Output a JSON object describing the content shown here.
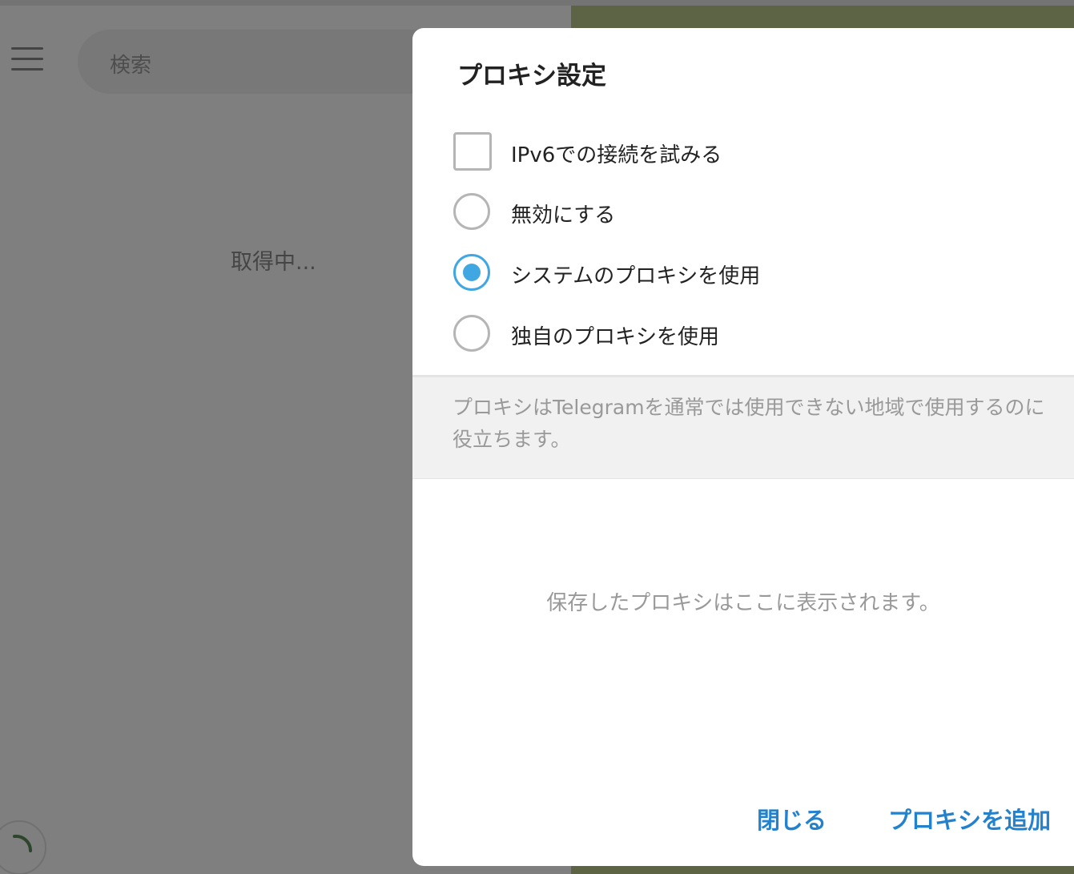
{
  "sidebar": {
    "search_placeholder": "検索",
    "loading_text": "取得中..."
  },
  "dialog": {
    "title": "プロキシ設定",
    "ipv6_label": "IPv6での接続を試みる",
    "ipv6_checked": false,
    "options": [
      {
        "label": "無効にする",
        "selected": false
      },
      {
        "label": "システムのプロキシを使用",
        "selected": true
      },
      {
        "label": "独自のプロキシを使用",
        "selected": false
      }
    ],
    "info_text": "プロキシはTelegramを通常では使用できない地域で使用するのに役立ちます。",
    "empty_text": "保存したプロキシはここに表示されます。",
    "close_label": "閉じる",
    "add_label": "プロキシを追加"
  },
  "colors": {
    "accent": "#40a7e3",
    "button_text": "#2481cc",
    "info_bg": "#f1f1f1"
  }
}
